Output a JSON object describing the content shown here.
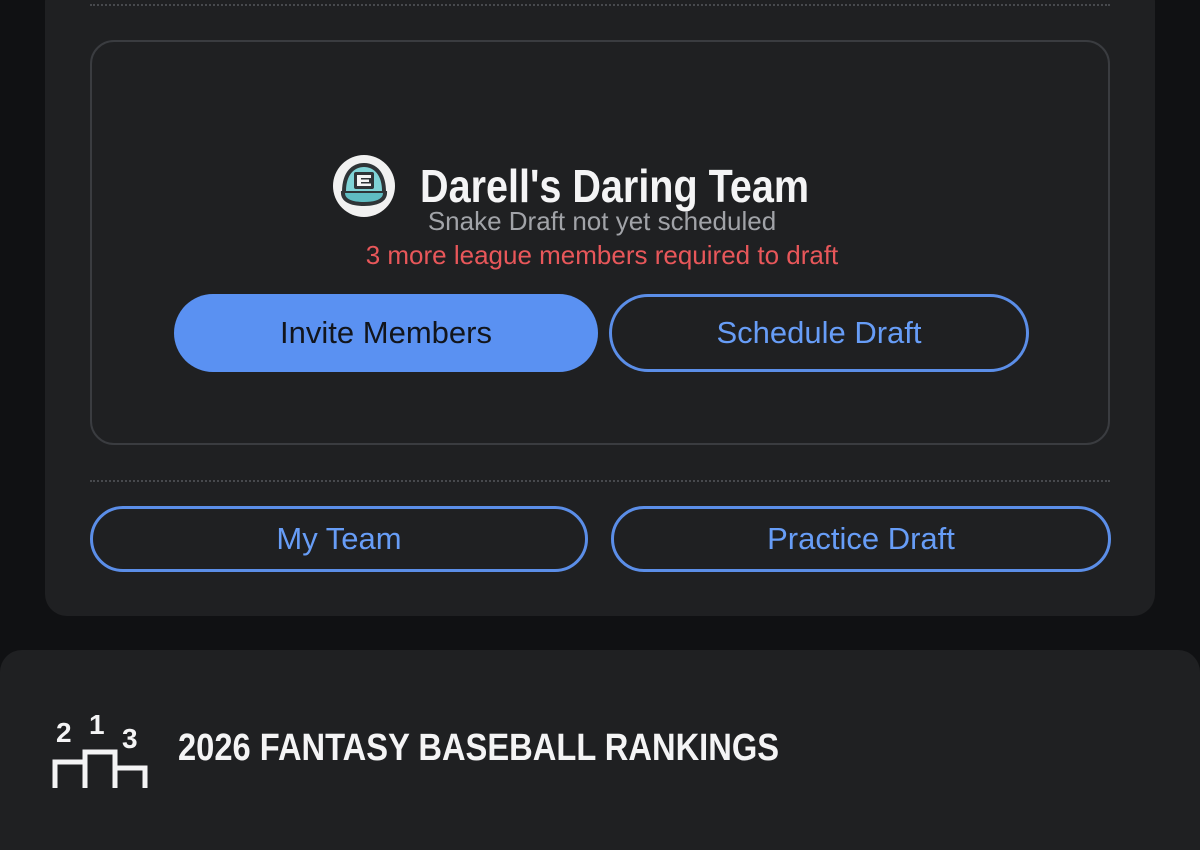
{
  "team": {
    "name": "Darell's Daring Team",
    "icon": "cap-icon"
  },
  "draft": {
    "status": "Snake Draft not yet scheduled",
    "warning": "3 more league members required to draft",
    "warning_color": "#e8575a"
  },
  "actions": {
    "invite_label": "Invite Members",
    "schedule_label": "Schedule Draft",
    "my_team_label": "My Team",
    "practice_label": "Practice Draft"
  },
  "rankings": {
    "title": "2026 FANTASY BASEBALL RANKINGS",
    "icon": "podium-icon"
  },
  "colors": {
    "accent": "#5a91f2",
    "card_bg": "#1f2022",
    "page_bg": "#101113"
  }
}
